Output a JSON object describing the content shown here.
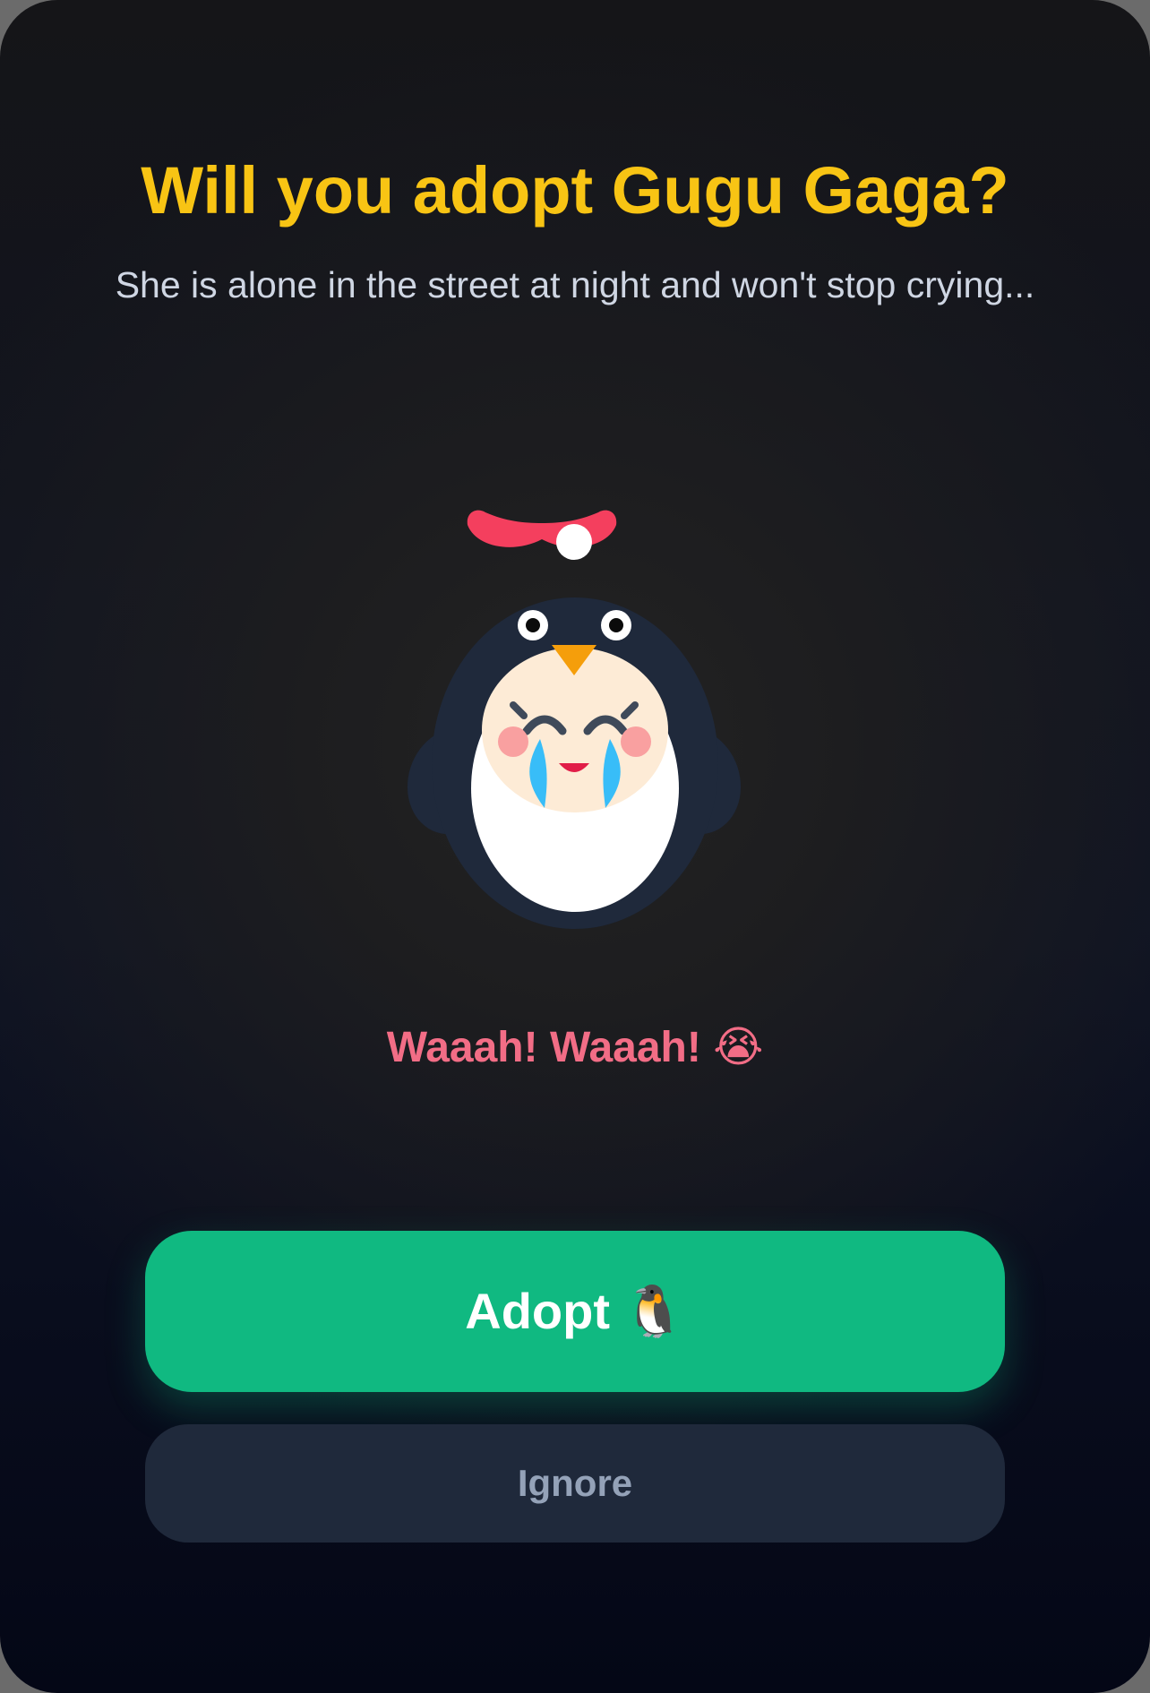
{
  "prompt": {
    "title": "Will you adopt Gugu Gaga?",
    "subtitle": "She is alone in the street at night and won't stop crying..."
  },
  "character": {
    "icon": "crying-penguin-icon",
    "cry_text": "Waaah! Waaah!",
    "cry_emoji": "😭"
  },
  "actions": {
    "adopt_label": "Adopt",
    "adopt_emoji": "🐧",
    "ignore_label": "Ignore"
  },
  "colors": {
    "title": "#f8c414",
    "cry_text": "#f26d86",
    "adopt_button": "#10b981",
    "ignore_button": "#1f293b",
    "ignore_text": "#94a2b8",
    "hair_bow": "#f43f5e",
    "penguin_body": "#1f293b",
    "beak": "#f59e0b",
    "tears": "#38bdf8"
  }
}
